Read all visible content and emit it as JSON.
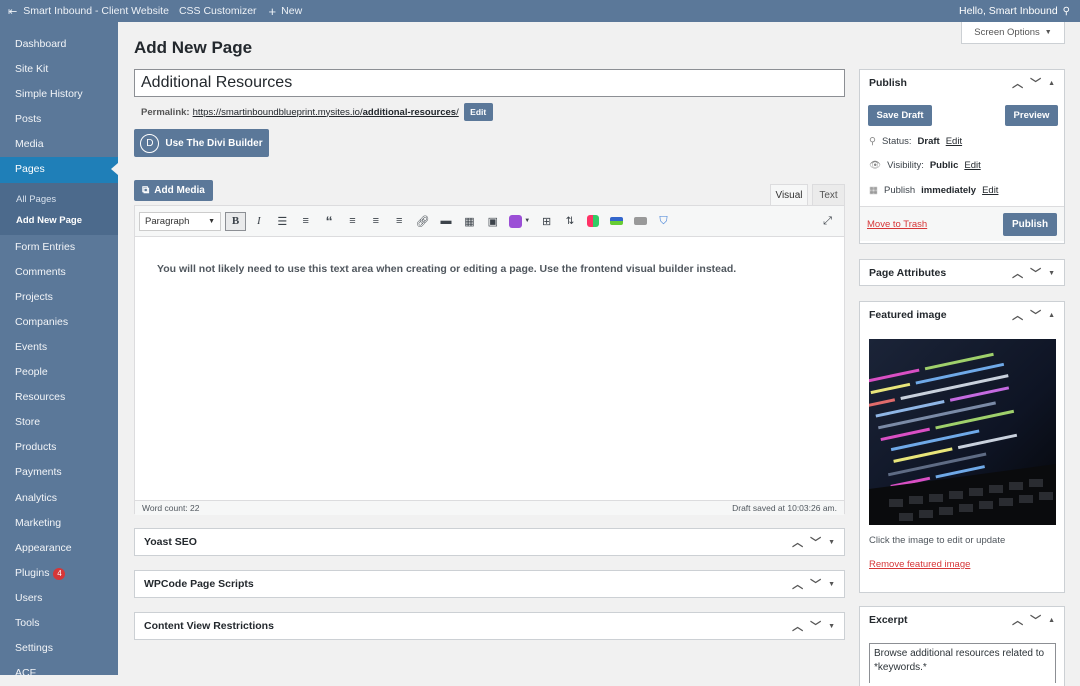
{
  "adminbar": {
    "site_name": "Smart Inbound - Client Website",
    "customizer": "CSS Customizer",
    "new_label": "New",
    "greeting": "Hello, Smart Inbound"
  },
  "sidebar": {
    "items_before": [
      "Dashboard",
      "Site Kit",
      "Simple History",
      "Posts",
      "Media"
    ],
    "active": "Pages",
    "submenu": [
      "All Pages",
      "Add New Page"
    ],
    "items_after": [
      "Form Entries",
      "Comments",
      "Projects",
      "Companies",
      "Events",
      "People",
      "Resources",
      "Store",
      "Products",
      "Payments",
      "Analytics",
      "Marketing",
      "Appearance"
    ],
    "plugins_label": "Plugins",
    "plugins_badge": "4",
    "items_end": [
      "Users",
      "Tools",
      "Settings",
      "ACF"
    ]
  },
  "page": {
    "heading": "Add New Page",
    "screen_options": "Screen Options",
    "title_value": "Additional Resources",
    "permalink_label": "Permalink:",
    "permalink_base": "https://smartinboundblueprint.mysites.io/",
    "permalink_slug": "additional-resources",
    "permalink_end": "/",
    "permalink_edit": "Edit",
    "divi_letter": "D",
    "divi_label": "Use The Divi Builder",
    "add_media": "Add Media",
    "tab_visual": "Visual",
    "tab_text": "Text",
    "format_select": "Paragraph",
    "editor_text": "You will not likely need to use this text area when creating or editing a page. Use the frontend visual builder instead.",
    "word_count": "Word count: 22",
    "draft_saved": "Draft saved at 10:03:26 am."
  },
  "metaboxes": [
    "Yoast SEO",
    "WPCode Page Scripts",
    "Content View Restrictions"
  ],
  "publish": {
    "title": "Publish",
    "save_draft": "Save Draft",
    "preview": "Preview",
    "status_label": "Status:",
    "status_value": "Draft",
    "visibility_label": "Visibility:",
    "visibility_value": "Public",
    "publish_label": "Publish",
    "publish_value": "immediately",
    "edit": "Edit",
    "trash": "Move to Trash",
    "publish_button": "Publish"
  },
  "page_attributes": {
    "title": "Page Attributes"
  },
  "featured": {
    "title": "Featured image",
    "hint": "Click the image to edit or update",
    "remove": "Remove featured image"
  },
  "excerpt": {
    "title": "Excerpt",
    "value": "Browse additional resources related to *keywords.*"
  },
  "colors": {
    "admin_blue": "#5b7899",
    "active_blue": "#1f7fb8",
    "badge_red": "#d63638"
  }
}
